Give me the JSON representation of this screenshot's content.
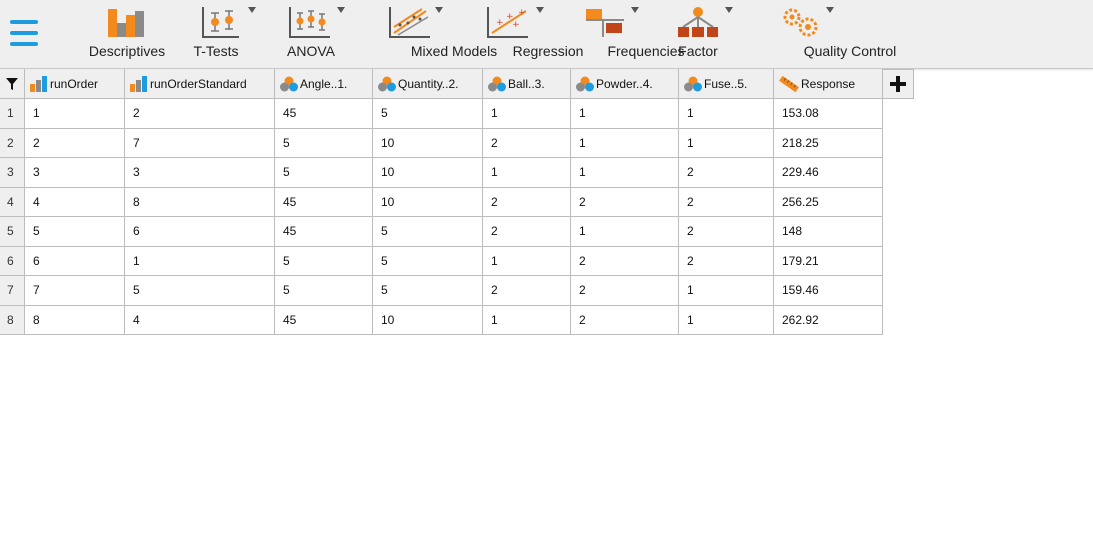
{
  "toolbar": {
    "tools": [
      {
        "id": "descriptives",
        "label": "Descriptives",
        "icon": "descriptives-icon",
        "has_menu": false
      },
      {
        "id": "t-tests",
        "label": "T-Tests",
        "icon": "t-tests-icon",
        "has_menu": true
      },
      {
        "id": "anova",
        "label": "ANOVA",
        "icon": "anova-icon",
        "has_menu": true
      },
      {
        "id": "mixed-models",
        "label": "Mixed Models",
        "icon": "mixed-models-icon",
        "has_menu": true
      },
      {
        "id": "regression",
        "label": "Regression",
        "icon": "regression-icon",
        "has_menu": true
      },
      {
        "id": "frequencies",
        "label": "Frequencies",
        "icon": "frequencies-icon",
        "has_menu": true
      },
      {
        "id": "factor",
        "label": "Factor",
        "icon": "factor-icon",
        "has_menu": true
      },
      {
        "id": "quality-control",
        "label": "Quality Control",
        "icon": "quality-control-icon",
        "has_menu": true
      }
    ]
  },
  "grid": {
    "columns": [
      {
        "name": "runOrder",
        "type": "scale"
      },
      {
        "name": "runOrderStandard",
        "type": "scale"
      },
      {
        "name": "Angle..1.",
        "type": "nominal"
      },
      {
        "name": "Quantity..2.",
        "type": "nominal"
      },
      {
        "name": "Ball..3.",
        "type": "nominal"
      },
      {
        "name": "Powder..4.",
        "type": "nominal"
      },
      {
        "name": "Fuse..5.",
        "type": "nominal"
      },
      {
        "name": "Response",
        "type": "continuous"
      }
    ],
    "rows": [
      {
        "num": "1",
        "cells": [
          "1",
          "2",
          "45",
          "5",
          "1",
          "1",
          "1",
          "153.08"
        ]
      },
      {
        "num": "2",
        "cells": [
          "2",
          "7",
          "5",
          "10",
          "2",
          "1",
          "1",
          "218.25"
        ]
      },
      {
        "num": "3",
        "cells": [
          "3",
          "3",
          "5",
          "10",
          "1",
          "1",
          "2",
          "229.46"
        ]
      },
      {
        "num": "4",
        "cells": [
          "4",
          "8",
          "45",
          "10",
          "2",
          "2",
          "2",
          "256.25"
        ]
      },
      {
        "num": "5",
        "cells": [
          "5",
          "6",
          "45",
          "5",
          "2",
          "1",
          "2",
          "148"
        ]
      },
      {
        "num": "6",
        "cells": [
          "6",
          "1",
          "5",
          "5",
          "1",
          "2",
          "2",
          "179.21"
        ]
      },
      {
        "num": "7",
        "cells": [
          "7",
          "5",
          "5",
          "5",
          "2",
          "2",
          "1",
          "159.46"
        ]
      },
      {
        "num": "8",
        "cells": [
          "8",
          "4",
          "45",
          "10",
          "1",
          "2",
          "1",
          "262.92"
        ]
      }
    ]
  },
  "colors": {
    "accent_blue": "#1f9be0",
    "accent_orange": "#f28a1e",
    "icon_gray": "#8a8a8a",
    "header_bg": "#efefef",
    "grid_line": "#bdbdbd"
  }
}
